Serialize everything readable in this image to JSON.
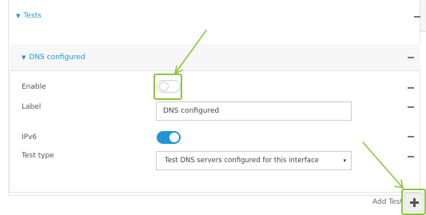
{
  "tests_section": {
    "title": "Tests",
    "caret": "▼"
  },
  "dns_section": {
    "title": "DNS configured",
    "caret": "▼"
  },
  "fields": {
    "enable": {
      "label": "Enable",
      "state": "off"
    },
    "label": {
      "label": "Label",
      "value": "DNS configured"
    },
    "ipv6": {
      "label": "IPv6",
      "state": "on"
    },
    "test_type": {
      "label": "Test type",
      "selected": "Test DNS servers configured for this interface",
      "caret": "▾"
    }
  },
  "add_test": {
    "label": "Add Test"
  },
  "colors": {
    "accent": "#2196d3",
    "highlight": "#8dc63f",
    "toggle_on": "#2196d3"
  },
  "icons": [
    "collapse-caret-icon",
    "remove-dash-icon",
    "plus-icon",
    "annotation-arrow-icon"
  ]
}
